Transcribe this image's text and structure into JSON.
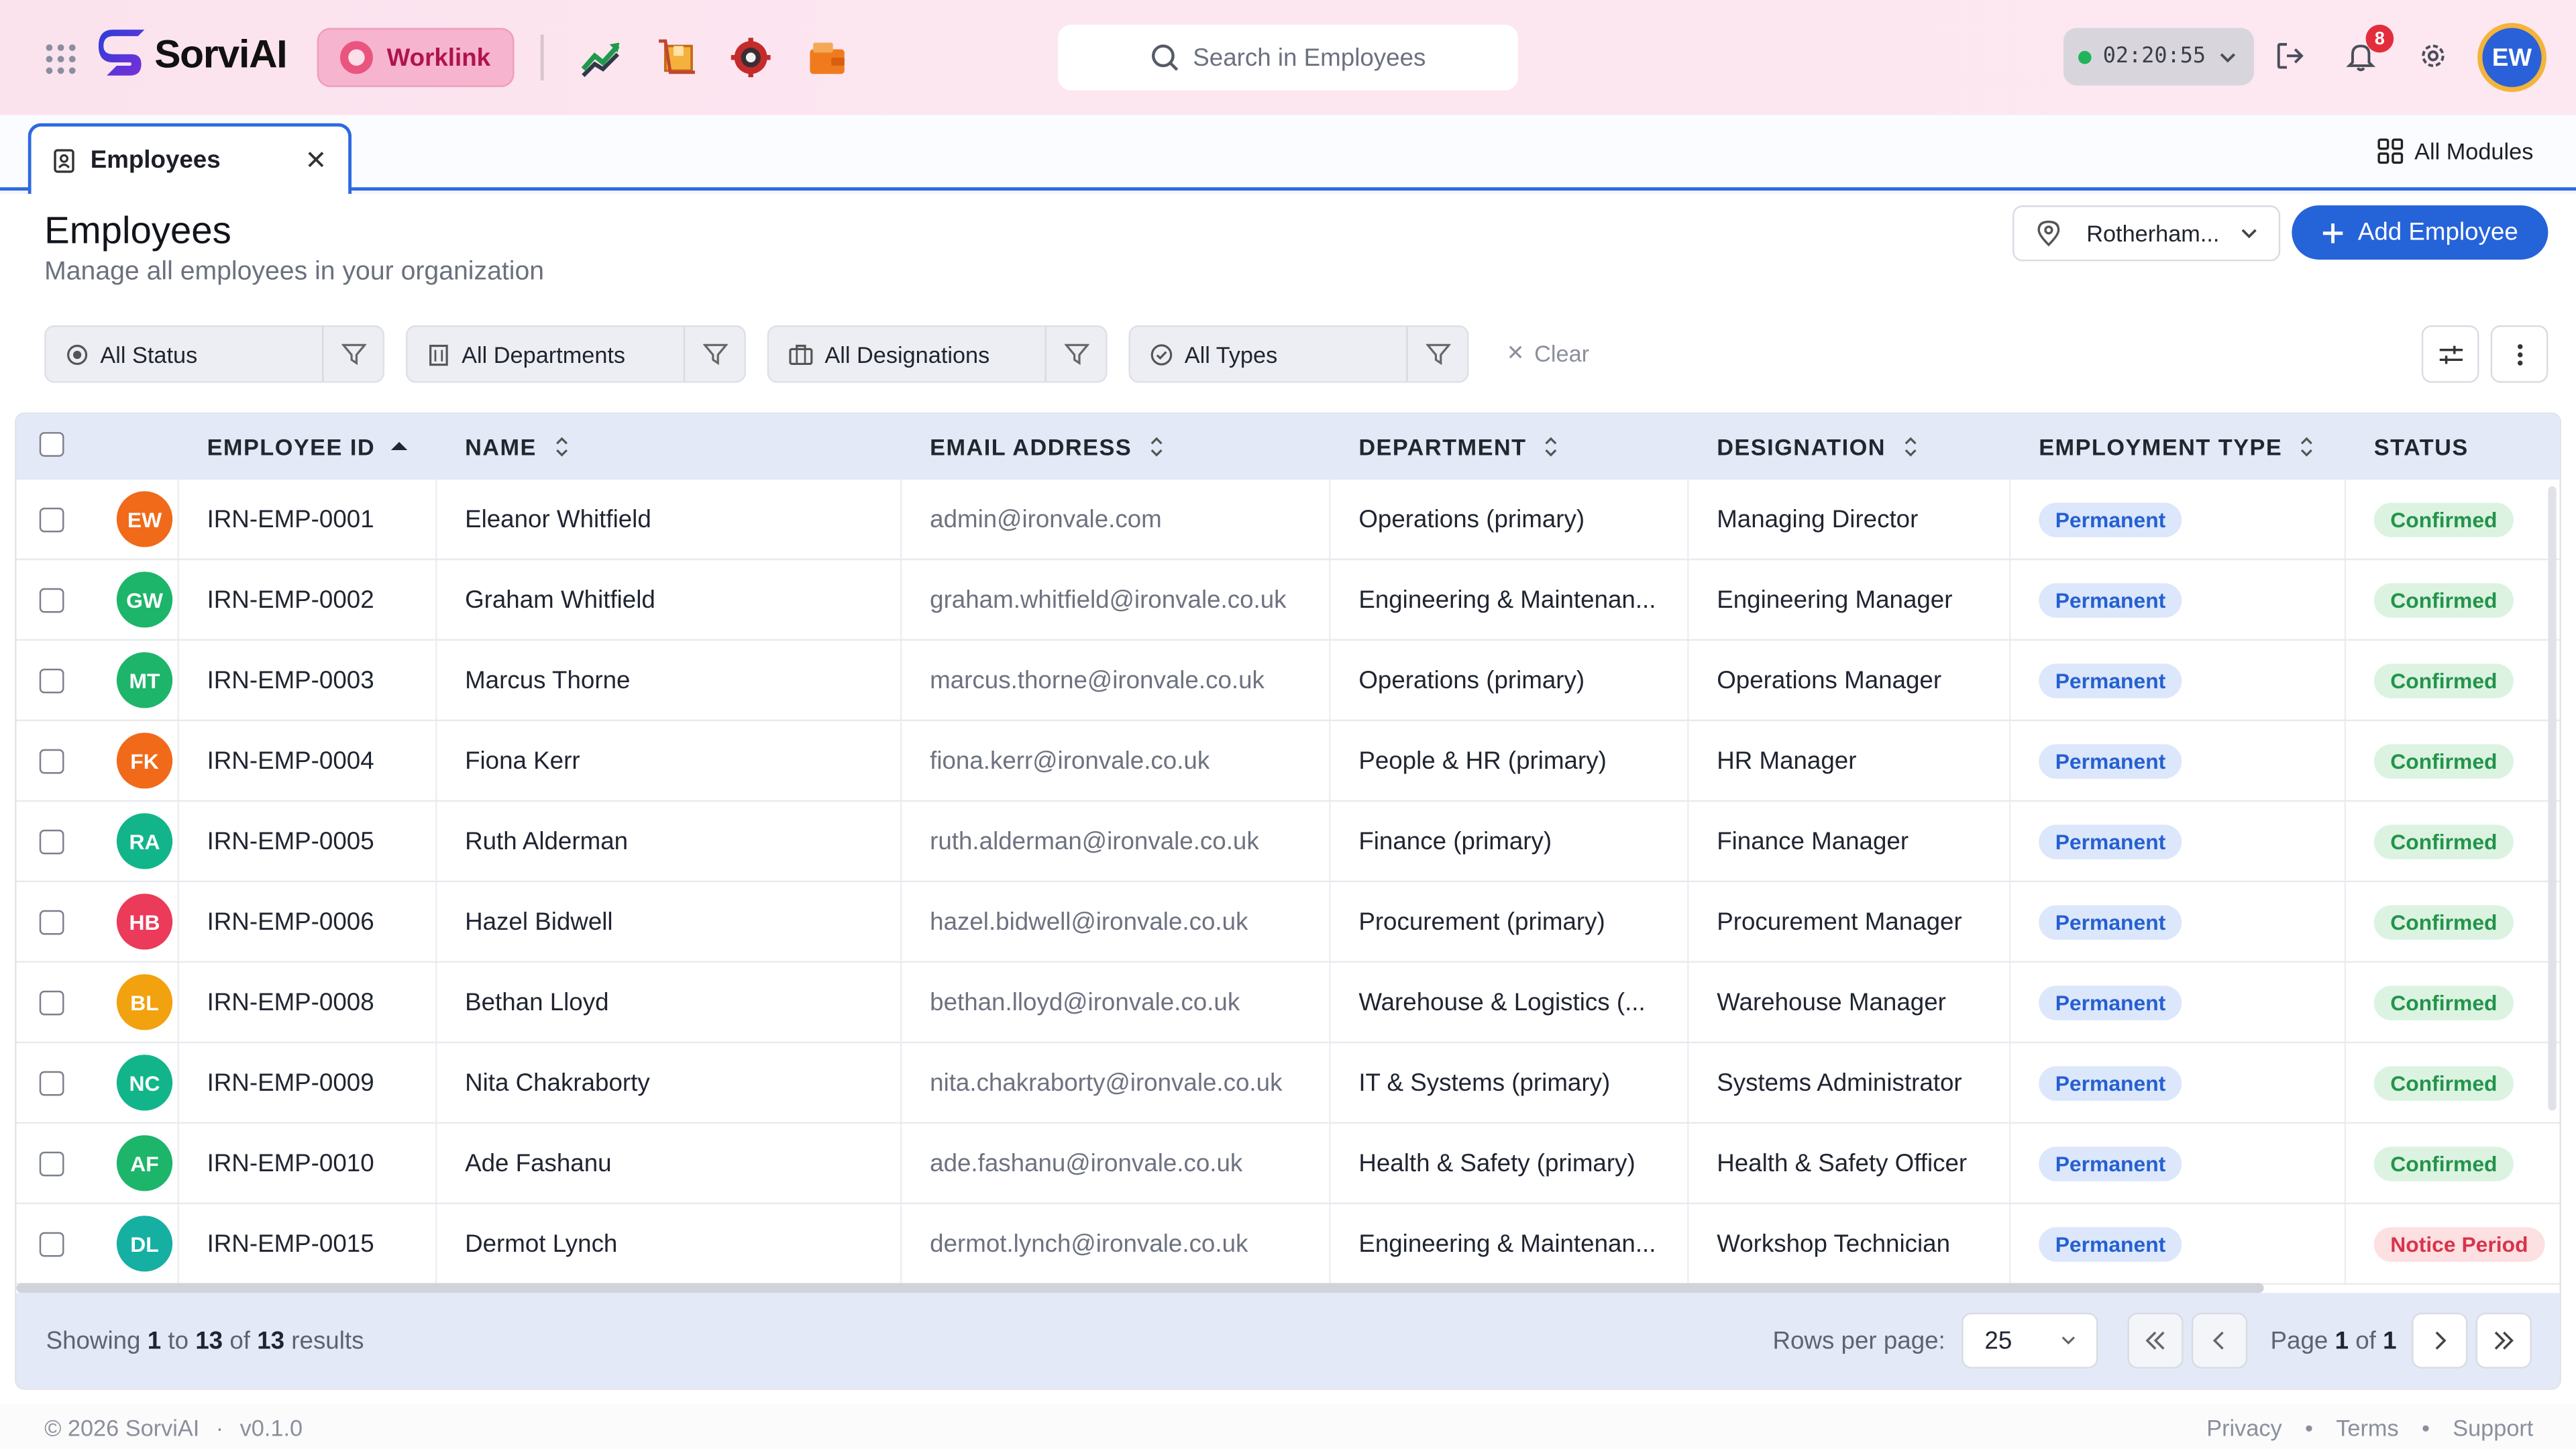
{
  "app": {
    "brand": "SorviAI",
    "active_module": "Worklink",
    "search_placeholder": "Search in Employees",
    "timer": "02:20:55",
    "notification_count": "8",
    "user_initials": "EW"
  },
  "tabs": {
    "active_tab": "Employees",
    "all_modules": "All Modules"
  },
  "header": {
    "title": "Employees",
    "subtitle": "Manage all employees in your organization",
    "location": "Rotherham...",
    "add_button": "Add Employee"
  },
  "filters": {
    "status": "All Status",
    "departments": "All Departments",
    "designations": "All Designations",
    "types": "All Types",
    "clear": "Clear"
  },
  "table": {
    "columns": {
      "employee_id": "EMPLOYEE ID",
      "name": "NAME",
      "email": "EMAIL ADDRESS",
      "department": "DEPARTMENT",
      "designation": "DESIGNATION",
      "employment_type": "EMPLOYMENT TYPE",
      "status": "STATUS"
    },
    "rows": [
      {
        "initials": "EW",
        "color": "#f06a1a",
        "id": "IRN-EMP-0001",
        "name": "Eleanor Whitfield",
        "email": "admin@ironvale.com",
        "department": "Operations (primary)",
        "designation": "Managing Director",
        "type": "Permanent",
        "status": "Confirmed",
        "status_kind": "conf"
      },
      {
        "initials": "GW",
        "color": "#1db56a",
        "id": "IRN-EMP-0002",
        "name": "Graham Whitfield",
        "email": "graham.whitfield@ironvale.co.uk",
        "department": "Engineering & Maintenan...",
        "designation": "Engineering Manager",
        "type": "Permanent",
        "status": "Confirmed",
        "status_kind": "conf"
      },
      {
        "initials": "MT",
        "color": "#1db56a",
        "id": "IRN-EMP-0003",
        "name": "Marcus Thorne",
        "email": "marcus.thorne@ironvale.co.uk",
        "department": "Operations (primary)",
        "designation": "Operations Manager",
        "type": "Permanent",
        "status": "Confirmed",
        "status_kind": "conf"
      },
      {
        "initials": "FK",
        "color": "#f06a1a",
        "id": "IRN-EMP-0004",
        "name": "Fiona Kerr",
        "email": "fiona.kerr@ironvale.co.uk",
        "department": "People & HR (primary)",
        "designation": "HR Manager",
        "type": "Permanent",
        "status": "Confirmed",
        "status_kind": "conf"
      },
      {
        "initials": "RA",
        "color": "#12b58a",
        "id": "IRN-EMP-0005",
        "name": "Ruth Alderman",
        "email": "ruth.alderman@ironvale.co.uk",
        "department": "Finance (primary)",
        "designation": "Finance Manager",
        "type": "Permanent",
        "status": "Confirmed",
        "status_kind": "conf"
      },
      {
        "initials": "HB",
        "color": "#ec3a5a",
        "id": "IRN-EMP-0006",
        "name": "Hazel Bidwell",
        "email": "hazel.bidwell@ironvale.co.uk",
        "department": "Procurement (primary)",
        "designation": "Procurement Manager",
        "type": "Permanent",
        "status": "Confirmed",
        "status_kind": "conf"
      },
      {
        "initials": "BL",
        "color": "#f2a10f",
        "id": "IRN-EMP-0008",
        "name": "Bethan Lloyd",
        "email": "bethan.lloyd@ironvale.co.uk",
        "department": "Warehouse & Logistics (...",
        "designation": "Warehouse Manager",
        "type": "Permanent",
        "status": "Confirmed",
        "status_kind": "conf"
      },
      {
        "initials": "NC",
        "color": "#12b58a",
        "id": "IRN-EMP-0009",
        "name": "Nita Chakraborty",
        "email": "nita.chakraborty@ironvale.co.uk",
        "department": "IT & Systems (primary)",
        "designation": "Systems Administrator",
        "type": "Permanent",
        "status": "Confirmed",
        "status_kind": "conf"
      },
      {
        "initials": "AF",
        "color": "#1db56a",
        "id": "IRN-EMP-0010",
        "name": "Ade Fashanu",
        "email": "ade.fashanu@ironvale.co.uk",
        "department": "Health & Safety (primary)",
        "designation": "Health & Safety Officer",
        "type": "Permanent",
        "status": "Confirmed",
        "status_kind": "conf"
      },
      {
        "initials": "DL",
        "color": "#16b0a3",
        "id": "IRN-EMP-0015",
        "name": "Dermot Lynch",
        "email": "dermot.lynch@ironvale.co.uk",
        "department": "Engineering & Maintenan...",
        "designation": "Workshop Technician",
        "type": "Permanent",
        "status": "Notice Period",
        "status_kind": "notice"
      }
    ]
  },
  "pager": {
    "showing_prefix": "Showing",
    "from": "1",
    "to_word": "to",
    "to": "13",
    "of_word": "of",
    "total": "13",
    "results_word": "results",
    "rows_label": "Rows per page:",
    "rows_value": "25",
    "page_word": "Page",
    "page": "1",
    "page_of": "of",
    "pages": "1"
  },
  "footer": {
    "copyright": "© 2026 SorviAI",
    "version": "v0.1.0",
    "privacy": "Privacy",
    "terms": "Terms",
    "support": "Support"
  }
}
